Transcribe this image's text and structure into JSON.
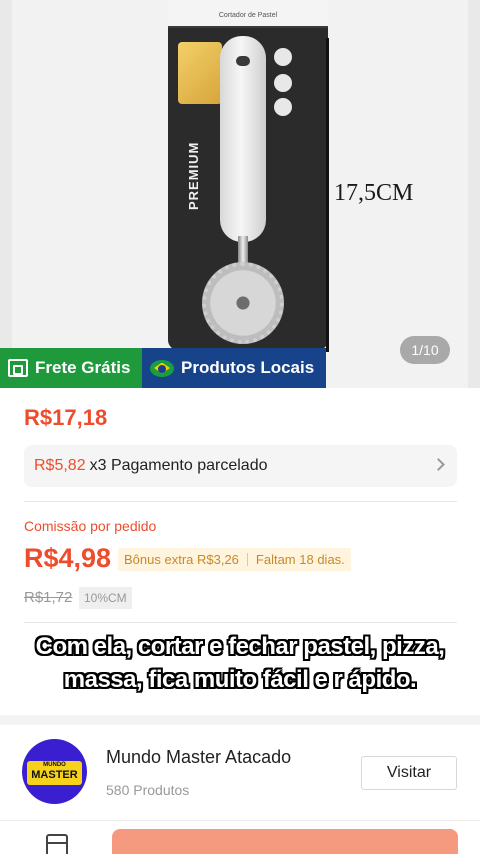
{
  "product_image": {
    "package_brand": "Cortador de Pastel",
    "side_text": "PREMIUM",
    "measurement": "17,5CM",
    "counter": "1/10"
  },
  "tags": {
    "free_shipping": "Frete Grátis",
    "local_products": "Produtos Locais"
  },
  "price": "R$17,18",
  "installment": {
    "price": "R$5,82",
    "text": "x3 Pagamento parcelado"
  },
  "commission": {
    "label": "Comissão por pedido",
    "value": "R$4,98",
    "bonus": "Bônus extra R$3,26",
    "days_left": "Faltam 18 dias.",
    "old_value": "R$1,72",
    "percent": "10%CM"
  },
  "caption": "Com ela, cortar e fechar pastel, pizza, massa, fica muito fácil e r ápido.",
  "store": {
    "logo_small": "MUNDO",
    "logo_big": "MASTER",
    "name": "Mundo Master Atacado",
    "products": "580 Produtos",
    "visit_label": "Visitar"
  },
  "colors": {
    "accent": "#ee4d2d",
    "free_shipping_bg": "#1e9a3c",
    "local_bg": "#16438a",
    "store_logo_bg": "#3a1fd0"
  }
}
